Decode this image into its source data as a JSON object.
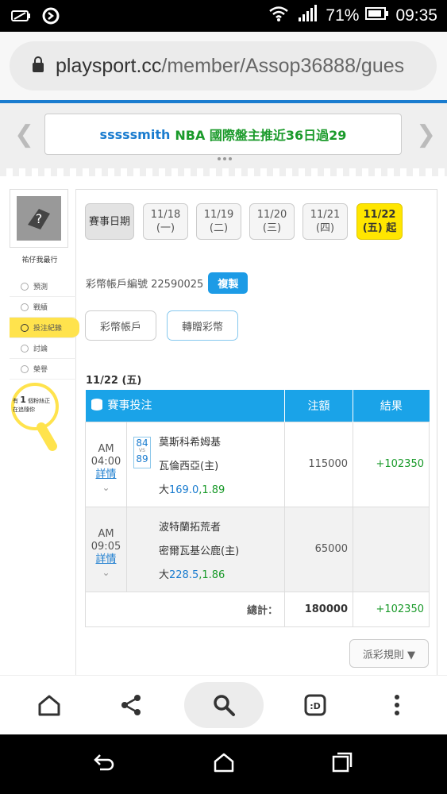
{
  "status_bar": {
    "battery_pct": "71%",
    "time": "09:35"
  },
  "browser": {
    "domain": "playsport.cc",
    "path": "/member/Assop36888/gues"
  },
  "banner": {
    "user": "sssssmith",
    "text": "NBA 國際盤主推近36日過29"
  },
  "sidebar": {
    "username": "祐仔我最行",
    "items": [
      {
        "label": "預測"
      },
      {
        "label": "戰績"
      },
      {
        "label": "投注紀錄"
      },
      {
        "label": "討論"
      },
      {
        "label": "榮譽"
      }
    ],
    "bulb_line1": "有",
    "bulb_count": "1",
    "bulb_line2": "個粉絲正",
    "bulb_line3": "在追隨你"
  },
  "date_filter": {
    "label": "賽事日期",
    "dates": [
      {
        "date": "11/18",
        "day": "(一)"
      },
      {
        "date": "11/19",
        "day": "(二)"
      },
      {
        "date": "11/20",
        "day": "(三)"
      },
      {
        "date": "11/21",
        "day": "(四)"
      },
      {
        "date": "11/22",
        "day": "(五) 起"
      }
    ]
  },
  "account": {
    "label": "彩幣帳戶編號 22590025",
    "copy": "複製"
  },
  "tabs": {
    "wallet": "彩幣帳戶",
    "transfer": "轉贈彩幣"
  },
  "day_label": "11/22 (五)",
  "table": {
    "headers": {
      "bet": "賽事投注",
      "amount": "注額",
      "result": "結果"
    },
    "rows": [
      {
        "ampm": "AM",
        "time": "04:00",
        "detail": "詳情",
        "score_away": "84",
        "score_vs": "VS",
        "score_home": "89",
        "away": "莫斯科希姆基",
        "home": "瓦倫西亞(主)",
        "pick": "大",
        "line": "169.0",
        "odds": ",1.89",
        "amount": "115000",
        "result": "+102350"
      },
      {
        "ampm": "AM",
        "time": "09:05",
        "detail": "詳情",
        "away": "波特蘭拓荒者",
        "home": "密爾瓦基公鹿(主)",
        "pick": "大",
        "line": "228.5",
        "odds": ",1.86",
        "amount": "65000",
        "result": ""
      }
    ],
    "total_label": "總計：",
    "total_amount": "180000",
    "total_result": "+102350"
  },
  "rules_button": "派彩規則 ▼",
  "colors": {
    "accent_blue": "#1aa3e8",
    "active_date": "#ffe600",
    "win_green": "#1a9a2a"
  }
}
